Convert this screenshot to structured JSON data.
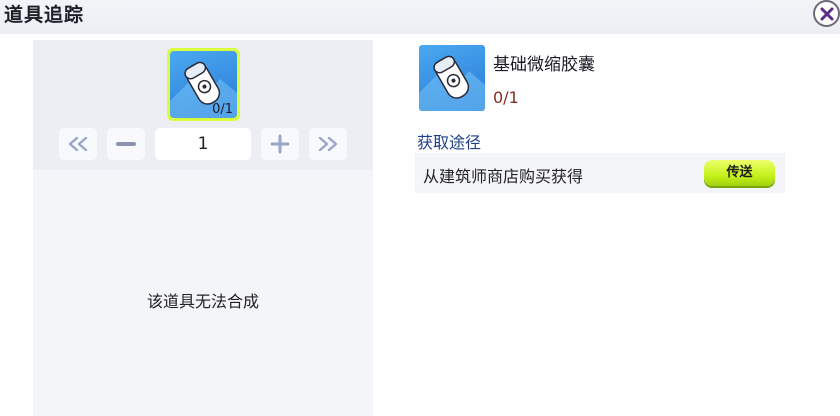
{
  "window": {
    "title": "道具追踪"
  },
  "craft_panel": {
    "slot_count": "0/1",
    "quantity": "1",
    "message": "该道具无法合成"
  },
  "item_detail": {
    "name": "基础微缩胶囊",
    "count": "0/1"
  },
  "sources": {
    "heading": "获取途径",
    "items": [
      {
        "text": "从建筑师商店购买获得",
        "button_label": "传送"
      }
    ]
  },
  "colors": {
    "accent_lime": "#d8ff3a",
    "item_blue": "#3a8fe4",
    "count_red": "#8a2c22",
    "heading_blue": "#1e3f8a"
  }
}
